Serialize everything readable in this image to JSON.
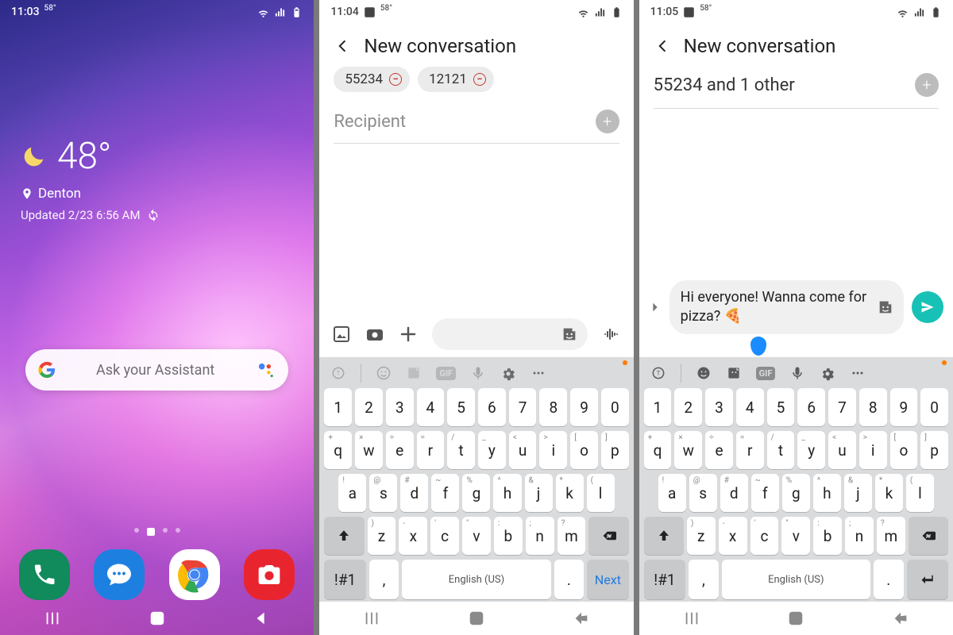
{
  "screen1": {
    "status": {
      "time": "11:03",
      "temp": "58°"
    },
    "weather": {
      "temperature": "48°",
      "location": "Denton",
      "updated": "Updated 2/23 6:56 AM"
    },
    "assistant_placeholder": "Ask your Assistant"
  },
  "screen2": {
    "status": {
      "time": "11:04",
      "temp": "58°"
    },
    "title": "New conversation",
    "chips": [
      "55234",
      "12121"
    ],
    "recipient_placeholder": "Recipient"
  },
  "screen3": {
    "status": {
      "time": "11:05",
      "temp": "58°"
    },
    "title": "New conversation",
    "recipients_summary": "55234 and 1 other",
    "message_text": "Hi everyone! Wanna come for pizza? 🍕"
  },
  "keyboard": {
    "row_num": [
      "1",
      "2",
      "3",
      "4",
      "5",
      "6",
      "7",
      "8",
      "9",
      "0"
    ],
    "row_q": [
      [
        "+",
        "q"
      ],
      [
        "×",
        "w"
      ],
      [
        "÷",
        "e"
      ],
      [
        "=",
        "r"
      ],
      [
        "/",
        "t"
      ],
      [
        "_",
        "y"
      ],
      [
        "<",
        "u"
      ],
      [
        ">",
        "i"
      ],
      [
        "[",
        "o"
      ],
      [
        "]",
        "p"
      ]
    ],
    "row_a": [
      [
        "!",
        "a"
      ],
      [
        "@",
        "s"
      ],
      [
        "#",
        "d"
      ],
      [
        "~",
        "f"
      ],
      [
        "%",
        "g"
      ],
      [
        "^",
        "h"
      ],
      [
        "&",
        "j"
      ],
      [
        "*",
        "k"
      ],
      [
        "(",
        "l"
      ]
    ],
    "row_z": [
      [
        ")",
        "z"
      ],
      [
        "-",
        "x"
      ],
      [
        "'",
        "c"
      ],
      [
        "\"",
        "v"
      ],
      [
        ":",
        "b"
      ],
      [
        ";",
        "n"
      ],
      [
        "?",
        "m"
      ]
    ],
    "sym": "!#1",
    "comma": ",",
    "period": ".",
    "space_label": "English (US)",
    "action_next": "Next"
  }
}
